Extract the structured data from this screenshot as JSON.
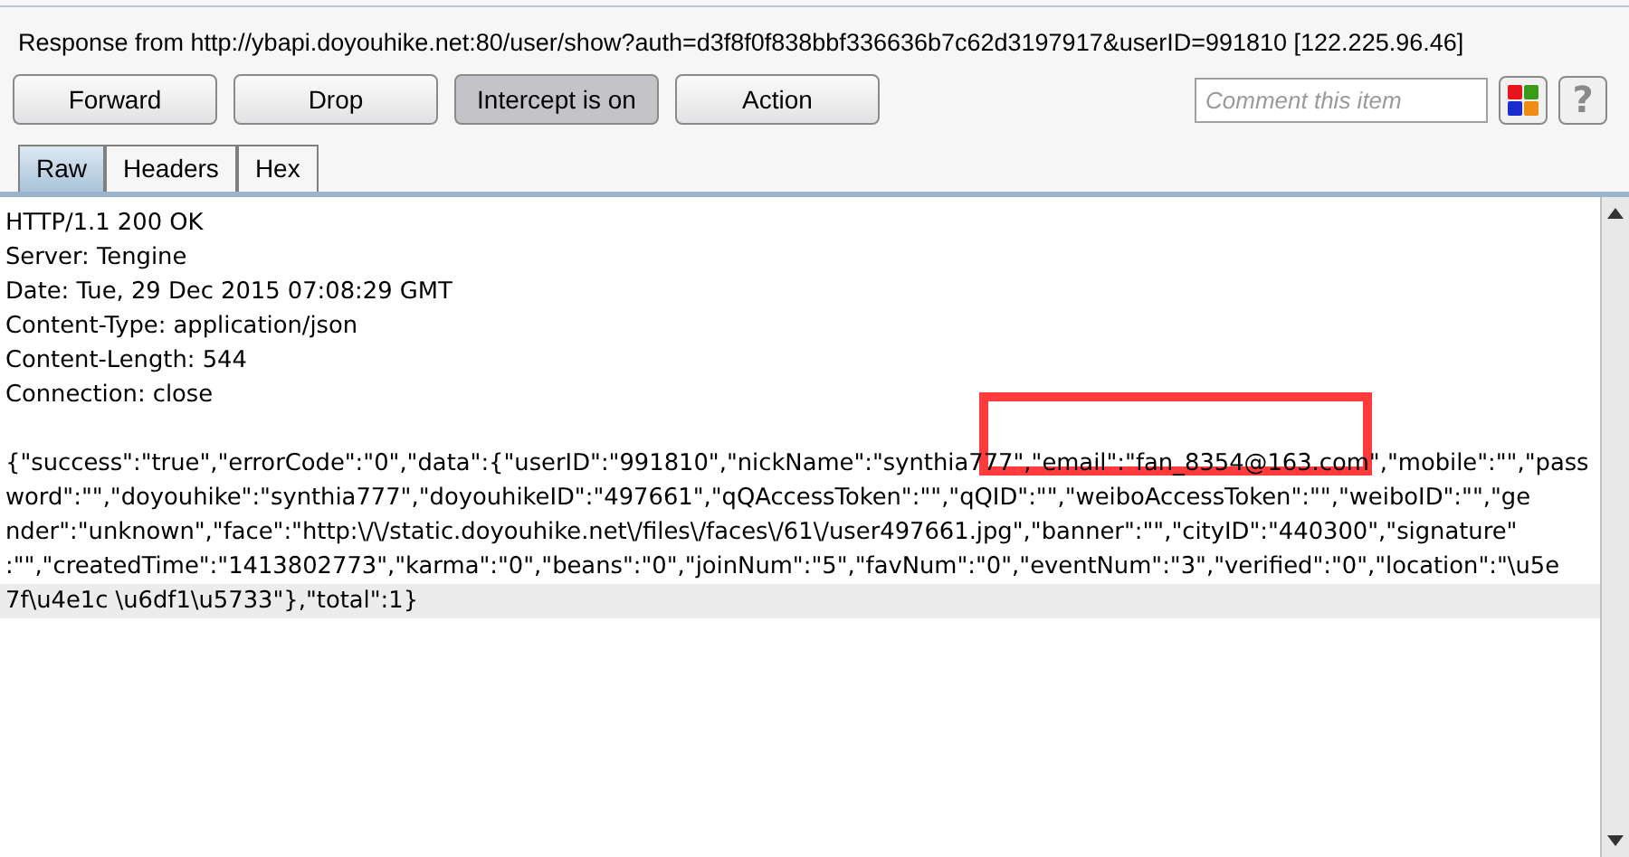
{
  "header": {
    "title": "Response from http://ybapi.doyouhike.net:80/user/show?auth=d3f8f0f838bbf336636b7c62d3197917&userID=991810  [122.225.96.46]"
  },
  "buttons": [
    {
      "label": "Forward",
      "pressed": false
    },
    {
      "label": "Drop",
      "pressed": false
    },
    {
      "label": "Intercept is on",
      "pressed": true
    },
    {
      "label": "Action",
      "pressed": false
    }
  ],
  "comment": {
    "placeholder": "Comment this item"
  },
  "help_button": {
    "label": "?"
  },
  "tabs": [
    {
      "label": "Raw",
      "selected": true
    },
    {
      "label": "Headers",
      "selected": false
    },
    {
      "label": "Hex",
      "selected": false
    }
  ],
  "lines": [
    {
      "text": "HTTP/1.1 200 OK",
      "selected": false
    },
    {
      "text": "Server: Tengine",
      "selected": false
    },
    {
      "text": "Date: Tue, 29 Dec 2015 07:08:29 GMT",
      "selected": false
    },
    {
      "text": "Content-Type: application/json",
      "selected": false
    },
    {
      "text": "Content-Length: 544",
      "selected": false
    },
    {
      "text": "Connection: close",
      "selected": false
    },
    {
      "selected": false
    },
    {
      "text": "{\"success\":\"true\",\"errorCode\":\"0\",\"data\":{\"userID\":\"991810\",\"nickName\":\"synthia777\",\"email\":\"fan_8354@163.com\",\"mobile\":\"\",\"pass",
      "selected": false
    },
    {
      "text": "word\":\"\",\"doyouhike\":\"synthia777\",\"doyouhikeID\":\"497661\",\"qQAccessToken\":\"\",\"qQID\":\"\",\"weiboAccessToken\":\"\",\"weiboID\":\"\",\"ge",
      "selected": false
    },
    {
      "text": "nder\":\"unknown\",\"face\":\"http:\\/\\/static.doyouhike.net\\/files\\/faces\\/61\\/user497661.jpg\",\"banner\":\"\",\"cityID\":\"440300\",\"signature\"",
      "selected": false
    },
    {
      "text": ":\"\",\"createdTime\":\"1413802773\",\"karma\":\"0\",\"beans\":\"0\",\"joinNum\":\"5\",\"favNum\":\"0\",\"eventNum\":\"3\",\"verified\":\"0\",\"location\":\"\\u5e",
      "selected": false
    },
    {
      "text": "7f\\u4e1c \\u6df1\\u5733\"},\"total\":1}",
      "selected": true
    }
  ]
}
